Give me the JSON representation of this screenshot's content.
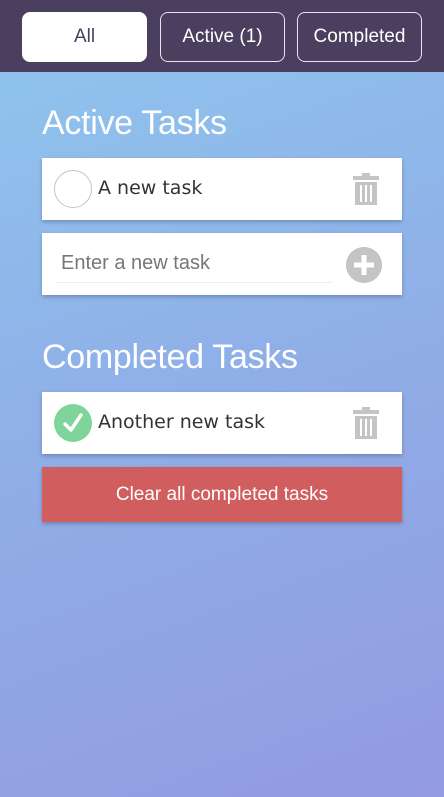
{
  "filters": {
    "all_label": "All",
    "active_label": "Active (1)",
    "completed_label": "Completed"
  },
  "active_section": {
    "title": "Active Tasks",
    "tasks": [
      {
        "text": "A new task",
        "completed": false
      }
    ]
  },
  "new_task": {
    "placeholder": "Enter a new task",
    "value": ""
  },
  "completed_section": {
    "title": "Completed Tasks",
    "tasks": [
      {
        "text": "Another new task",
        "completed": true
      }
    ]
  },
  "clear_button_label": "Clear all completed tasks",
  "icons": {
    "trash": "trash-icon",
    "add": "plus-circle-icon",
    "check": "checkmark-icon"
  },
  "colors": {
    "topbar": "#4a3f5e",
    "clear_button": "#d15e5e",
    "done_check": "#7ed49a"
  }
}
